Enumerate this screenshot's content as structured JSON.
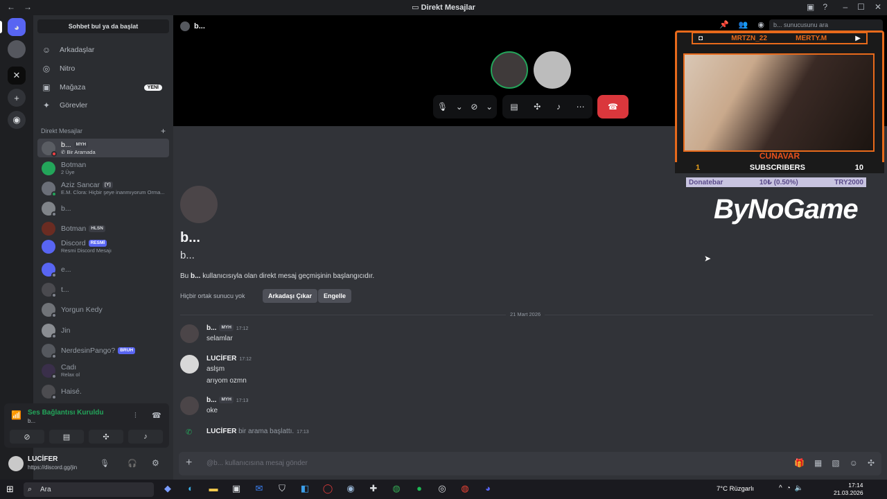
{
  "window": {
    "title": "Direkt Mesajlar",
    "back": "←",
    "forward": "→"
  },
  "sidebar": {
    "search_label": "Sohbet bul ya da başlat",
    "nav": [
      {
        "label": "Arkadaşlar",
        "icon": "friends-icon",
        "glyph": "☺"
      },
      {
        "label": "Nitro",
        "icon": "nitro-icon",
        "glyph": "◎"
      },
      {
        "label": "Mağaza",
        "icon": "shop-icon",
        "glyph": "▣",
        "badge": "YENİ"
      },
      {
        "label": "Görevler",
        "icon": "quests-icon",
        "glyph": "✦"
      }
    ],
    "dm_header": "Direkt Mesajlar",
    "dms": [
      {
        "name": "b...",
        "tag": "MYH",
        "sub": "Bir Aramada"
      },
      {
        "name": "Botman",
        "sub": "2 Üye"
      },
      {
        "name": "Aziz Sancar",
        "tag": "[Y]",
        "sub": "E.M. Cîora: Hiçbir şeye inanmıyorum Orma..."
      },
      {
        "name": "b..."
      },
      {
        "name": "Botman",
        "tag": "HLSN"
      },
      {
        "name": "Discord",
        "tag": "RESMİ",
        "sub": "Resmi Discord Mesajı"
      },
      {
        "name": "e..."
      },
      {
        "name": "t..."
      },
      {
        "name": "Yorgun Kedy"
      },
      {
        "name": "Jin"
      },
      {
        "name": "NerdesinPango?",
        "tag": "BRUH"
      },
      {
        "name": "Cadı",
        "sub": "Relax ol"
      },
      {
        "name": "Haisé."
      }
    ],
    "voice": {
      "status": "Ses Bağlantısı Kuruldu",
      "sub": "b..."
    },
    "user": {
      "name": "LUCİFER",
      "sub": "https://discord.gg/jin"
    }
  },
  "call": {
    "header": "b..."
  },
  "profile": {
    "name": "b...",
    "username": "b...",
    "intro_prefix": "Bu",
    "intro_name": "b...",
    "intro_suffix": "kullanıcısıyla olan direkt mesaj geçmişinin başlangıcıdır.",
    "mutual": "Hiçbir ortak sunucu yok",
    "remove_friend": "Arkadaşı Çıkar",
    "block": "Engelle"
  },
  "date_divider": "21 Mart 2026",
  "messages": [
    {
      "author": "b...",
      "tag": "MYH",
      "time": "17:12",
      "lines": [
        "selamlar"
      ]
    },
    {
      "author": "LUCİFER",
      "time": "17:12",
      "lines": [
        "aslşm",
        "arıyom ozmn"
      ]
    },
    {
      "author": "b...",
      "tag": "MYH",
      "time": "17:13",
      "lines": [
        "oke"
      ]
    }
  ],
  "call_event": {
    "author": "LUCİFER",
    "text": "bir arama başlattı.",
    "time": "17:13"
  },
  "composer": {
    "placeholder": "@b... kullanıcısına mesaj gönder"
  },
  "header_search": {
    "placeholder": "b... sunucusunu ara"
  },
  "overlay": {
    "left_name": "MRTZN_22",
    "right_name": "MERTY.M",
    "cam_name": "CUNAVAR",
    "subs_left": "1",
    "subs_label": "SUBSCRIBERS",
    "subs_right": "10",
    "donate_label": "Donatebar",
    "donate_progress": "10₺ (0.50%)",
    "donate_goal": "TRY2000",
    "brand": "ByNoGame"
  },
  "taskbar": {
    "search": "Ara",
    "weather": "7°C  Rüzgarlı",
    "time": "17:14",
    "date": "21.03.2026"
  },
  "colors": {
    "accent": "#5865f2",
    "online": "#23a55a",
    "danger": "#da373c",
    "overlay_orange": "#e86a1b"
  }
}
